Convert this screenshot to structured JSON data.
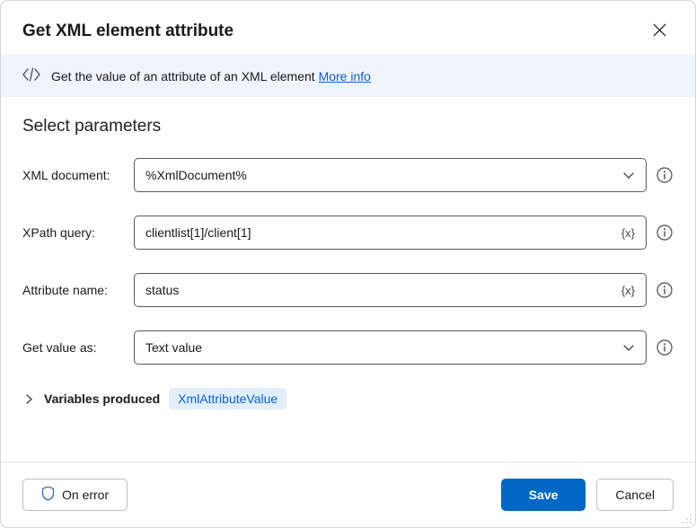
{
  "dialog": {
    "title": "Get XML element attribute"
  },
  "info": {
    "text": "Get the value of an attribute of an XML element",
    "more_link": "More info"
  },
  "section": {
    "title": "Select parameters"
  },
  "params": {
    "xml_document": {
      "label": "XML document:",
      "value": "%XmlDocument%"
    },
    "xpath_query": {
      "label": "XPath query:",
      "value": "clientlist[1]/client[1]",
      "var_badge": "{x}"
    },
    "attr_name": {
      "label": "Attribute name:",
      "value": "status",
      "var_badge": "{x}"
    },
    "get_value_as": {
      "label": "Get value as:",
      "value": "Text value"
    }
  },
  "variables": {
    "label": "Variables produced",
    "chip": "XmlAttributeValue"
  },
  "footer": {
    "on_error": "On error",
    "save": "Save",
    "cancel": "Cancel"
  }
}
